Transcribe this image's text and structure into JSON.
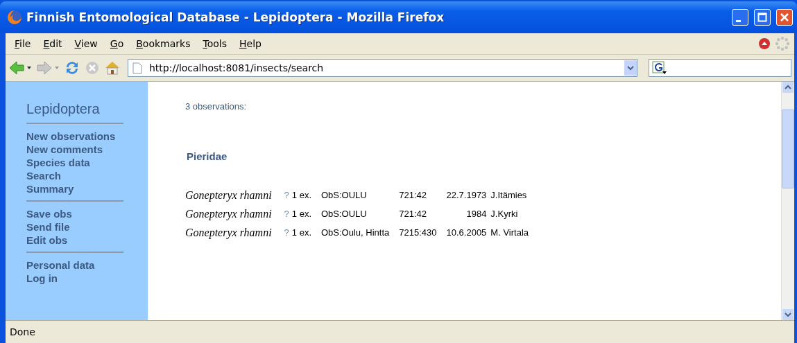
{
  "window": {
    "title": "Finnish Entomological Database - Lepidoptera - Mozilla Firefox"
  },
  "menu": [
    "File",
    "Edit",
    "View",
    "Go",
    "Bookmarks",
    "Tools",
    "Help"
  ],
  "address": {
    "value": "http://localhost:8081/insects/search"
  },
  "sidebar": {
    "title": "Lepidoptera",
    "groups": [
      [
        "New observations",
        "New comments",
        "Species data",
        "Search",
        "Summary"
      ],
      [
        "Save obs",
        "Send file",
        "Edit obs"
      ],
      [
        "Personal data",
        "Log in"
      ]
    ]
  },
  "content": {
    "count": "3 observations:",
    "family": "Pieridae",
    "rows": [
      {
        "species": "Gonepteryx rhamni",
        "query": "?",
        "count": "1 ex.",
        "collection": "ObS:OULU",
        "grid": "721:42",
        "date": "22.7.1973",
        "observer": "J.Itämies"
      },
      {
        "species": "Gonepteryx rhamni",
        "query": "?",
        "count": "1 ex.",
        "collection": "ObS:OULU",
        "grid": "721:42",
        "date": "1984",
        "observer": "J.Kyrki"
      },
      {
        "species": "Gonepteryx rhamni",
        "query": "?",
        "count": "1 ex.",
        "collection": "ObS:Oulu, Hintta",
        "grid": "7215:430",
        "date": "10.6.2005",
        "observer": "M. Virtala"
      }
    ]
  },
  "status_bar": "Done"
}
